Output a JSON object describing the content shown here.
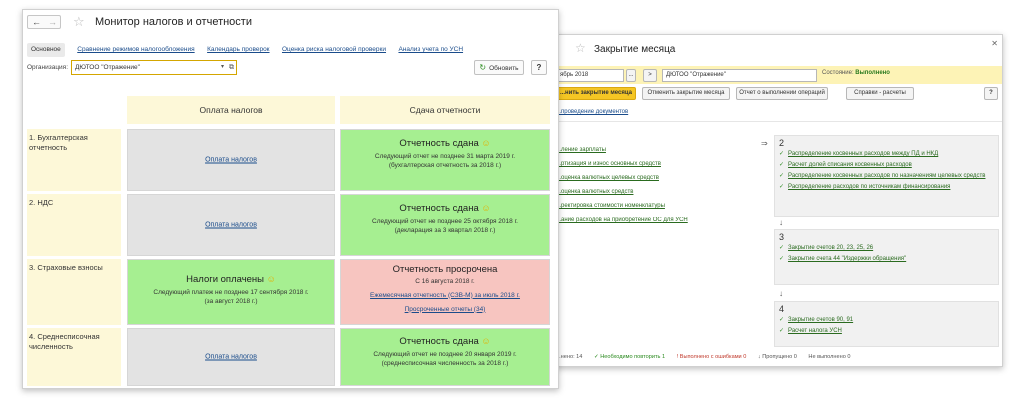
{
  "back_window": {
    "title": "Закрытие месяца",
    "period": "ябрь 2018",
    "period_btn_left": "...",
    "period_btn_right": ">",
    "org_value": "ДЮТОО \"Отражение\"",
    "state_label": "Состояние:",
    "state_value": "Выполнено",
    "toolbar": {
      "run": "...нить закрытие месяца",
      "cancel": "Отменить закрытие месяца",
      "report": "Отчет о выполнении операций",
      "refs": "Справки - расчеты",
      "help": "?"
    },
    "sublink": "...проведение документов",
    "left_tasks": [
      "...ление зарплаты",
      "...ртизация и износ основных средств",
      "...оценка валютных целевых средств",
      "...оценка валютных средств",
      "...ректировка стоимости номенклатуры",
      "...ание расходов на приобретение ОС для УСН"
    ],
    "stages": [
      {
        "num": "2",
        "items": [
          "Распределение косвенных расходов между ПД и НКД",
          "Расчет долей списания косвенных расходов",
          "Распределение косвенных расходов по назначениям целевых средств",
          "Распределение расходов по источникам финансирования"
        ]
      },
      {
        "num": "3",
        "items": [
          "Закрытие счетов 20, 23, 25, 26",
          "Закрытие счета 44 \"Издержки обращения\""
        ]
      },
      {
        "num": "4",
        "items": [
          "Закрытие счетов 90, 91",
          "Расчет налога УСН"
        ]
      }
    ],
    "status": {
      "done": "...нено: 14",
      "repeat": "✓ Необходимо повторить 1",
      "errors": "! Выполнено с ошибками 0",
      "skipped": "↓ Пропущено 0",
      "not_done": "Не выполнено 0"
    }
  },
  "front_window": {
    "title": "Монитор налогов и отчетности",
    "tabs": [
      "Основное",
      "Сравнение режимов налогообложения",
      "Календарь проверок",
      "Оценка риска налоговой проверки",
      "Анализ учета по УСН"
    ],
    "org_label": "Организация:",
    "org_value": "ДЮТОО \"Отражение\"",
    "refresh_label": "Обновить",
    "help": "?",
    "col_taxes": "Оплата налогов",
    "col_reports": "Сдача отчетности",
    "rows": [
      {
        "label": "1. Бухгалтерская отчетность",
        "tax_link": "Оплата налогов",
        "report_head": "Отчетность сдана",
        "report_line1": "Следующий отчет не позднее 31 марта 2019 г.",
        "report_line2": "(бухгалтерская отчетность за 2018 г.)"
      },
      {
        "label": "2. НДС",
        "tax_link": "Оплата налогов",
        "report_head": "Отчетность сдана",
        "report_line1": "Следующий отчет не позднее 25 октября 2018 г.",
        "report_line2": "(декларация за 3 квартал 2018 г.)"
      },
      {
        "label": "3. Страховые взносы",
        "tax_head": "Налоги оплачены",
        "tax_line1": "Следующий платеж не позднее 17 сентября 2018 г.",
        "tax_line2": "(за август 2018 г.)",
        "report_head": "Отчетность просрочена",
        "report_line1": "С 16 августа 2018 г.",
        "report_link1": "Ежемесячная отчетность (СЗВ-М) за июль 2018 г.",
        "report_link2": "Просроченные отчеты (34)"
      },
      {
        "label": "4. Среднесписочная численность",
        "tax_link": "Оплата налогов",
        "report_head": "Отчетность сдана",
        "report_line1": "Следующий отчет не позднее 20 января 2019 г.",
        "report_line2": "(среднесписочная численность за 2018 г.)"
      }
    ],
    "colors": {
      "ok": "#a6ef91",
      "overdue": "#f7c5c0",
      "neutral": "#e3e3e3",
      "header": "#fdf8d8"
    }
  }
}
